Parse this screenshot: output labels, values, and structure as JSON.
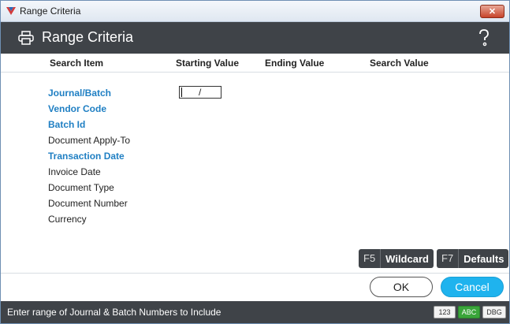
{
  "window": {
    "title": "Range Criteria",
    "close_label": "✕"
  },
  "header": {
    "title": "Range Criteria"
  },
  "columns": {
    "search_item": "Search Item",
    "starting_value": "Starting Value",
    "ending_value": "Ending Value",
    "search_value": "Search Value"
  },
  "items": [
    {
      "label": "Journal/Batch",
      "highlight": true
    },
    {
      "label": "Vendor Code",
      "highlight": true
    },
    {
      "label": "Batch Id",
      "highlight": true
    },
    {
      "label": "Document Apply-To",
      "highlight": false
    },
    {
      "label": "Transaction Date",
      "highlight": true
    },
    {
      "label": "Invoice Date",
      "highlight": false
    },
    {
      "label": "Document Type",
      "highlight": false
    },
    {
      "label": "Document Number",
      "highlight": false
    },
    {
      "label": "Currency",
      "highlight": false
    }
  ],
  "journal_batch_field": {
    "separator": "/"
  },
  "function_keys": [
    {
      "key": "F5",
      "label": "Wildcard"
    },
    {
      "key": "F7",
      "label": "Defaults"
    }
  ],
  "buttons": {
    "ok": "OK",
    "cancel": "Cancel"
  },
  "status": {
    "message": "Enter range of Journal & Batch Numbers to Include",
    "badges": [
      "123",
      "ABC",
      "DBG"
    ]
  },
  "colors": {
    "accent": "#1fb3ee",
    "key_field": "#1f7fc3",
    "dark_bar": "#3f4348"
  }
}
